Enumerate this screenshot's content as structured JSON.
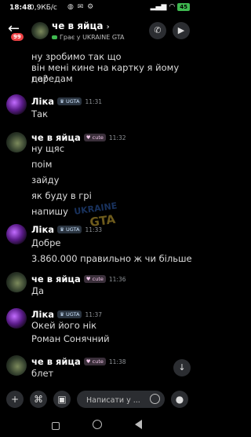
{
  "status_bar": {
    "time": "18:48",
    "network": "0,9КБ/с",
    "battery": "45"
  },
  "header": {
    "back_icon": "arrow-left",
    "unread_count": "99",
    "title": "че в яйца",
    "subtitle": "Грає у UKRAINE GTA",
    "call_icon": "phone",
    "video_icon": "video-camera"
  },
  "watermark": {
    "line1": "UKRAINE",
    "line2": "GTA"
  },
  "messages": {
    "top_lines": [
      "ну зробимо так що",
      "він мені кине на картку я йому передам",
      "да?"
    ],
    "m1": {
      "author": "Ліка",
      "tag": "UGTA",
      "time": "11:31",
      "lines": [
        "Так"
      ]
    },
    "m2": {
      "author": "че в яйца",
      "tag": "cute",
      "time": "11:32",
      "lines": [
        "ну щяс",
        "поім",
        "зайду",
        "як буду в грі",
        "напишу"
      ]
    },
    "m3": {
      "author": "Ліка",
      "tag": "UGTA",
      "time": "11:33",
      "lines": [
        "Добре",
        "3.860.000 правильно ж чи більше"
      ]
    },
    "m4": {
      "author": "че в яйца",
      "tag": "cute",
      "time": "11:36",
      "lines": [
        "Да"
      ]
    },
    "m5": {
      "author": "Ліка",
      "tag": "UGTA",
      "time": "11:37",
      "lines": [
        "Окей його нік",
        "Роман Сонячний"
      ]
    },
    "m6": {
      "author": "че в яйца",
      "tag": "cute",
      "time": "11:38",
      "lines": [
        "блет"
      ]
    }
  },
  "composer": {
    "placeholder": "Написати у ...",
    "add_icon": "plus",
    "game_icon": "gamepad",
    "gift_icon": "gift",
    "emoji_icon": "smiley"
  },
  "colors": {
    "background": "#000000",
    "accent_green": "#3fb950",
    "badge_red": "#ed4245",
    "button_bg": "#2b2d31"
  }
}
